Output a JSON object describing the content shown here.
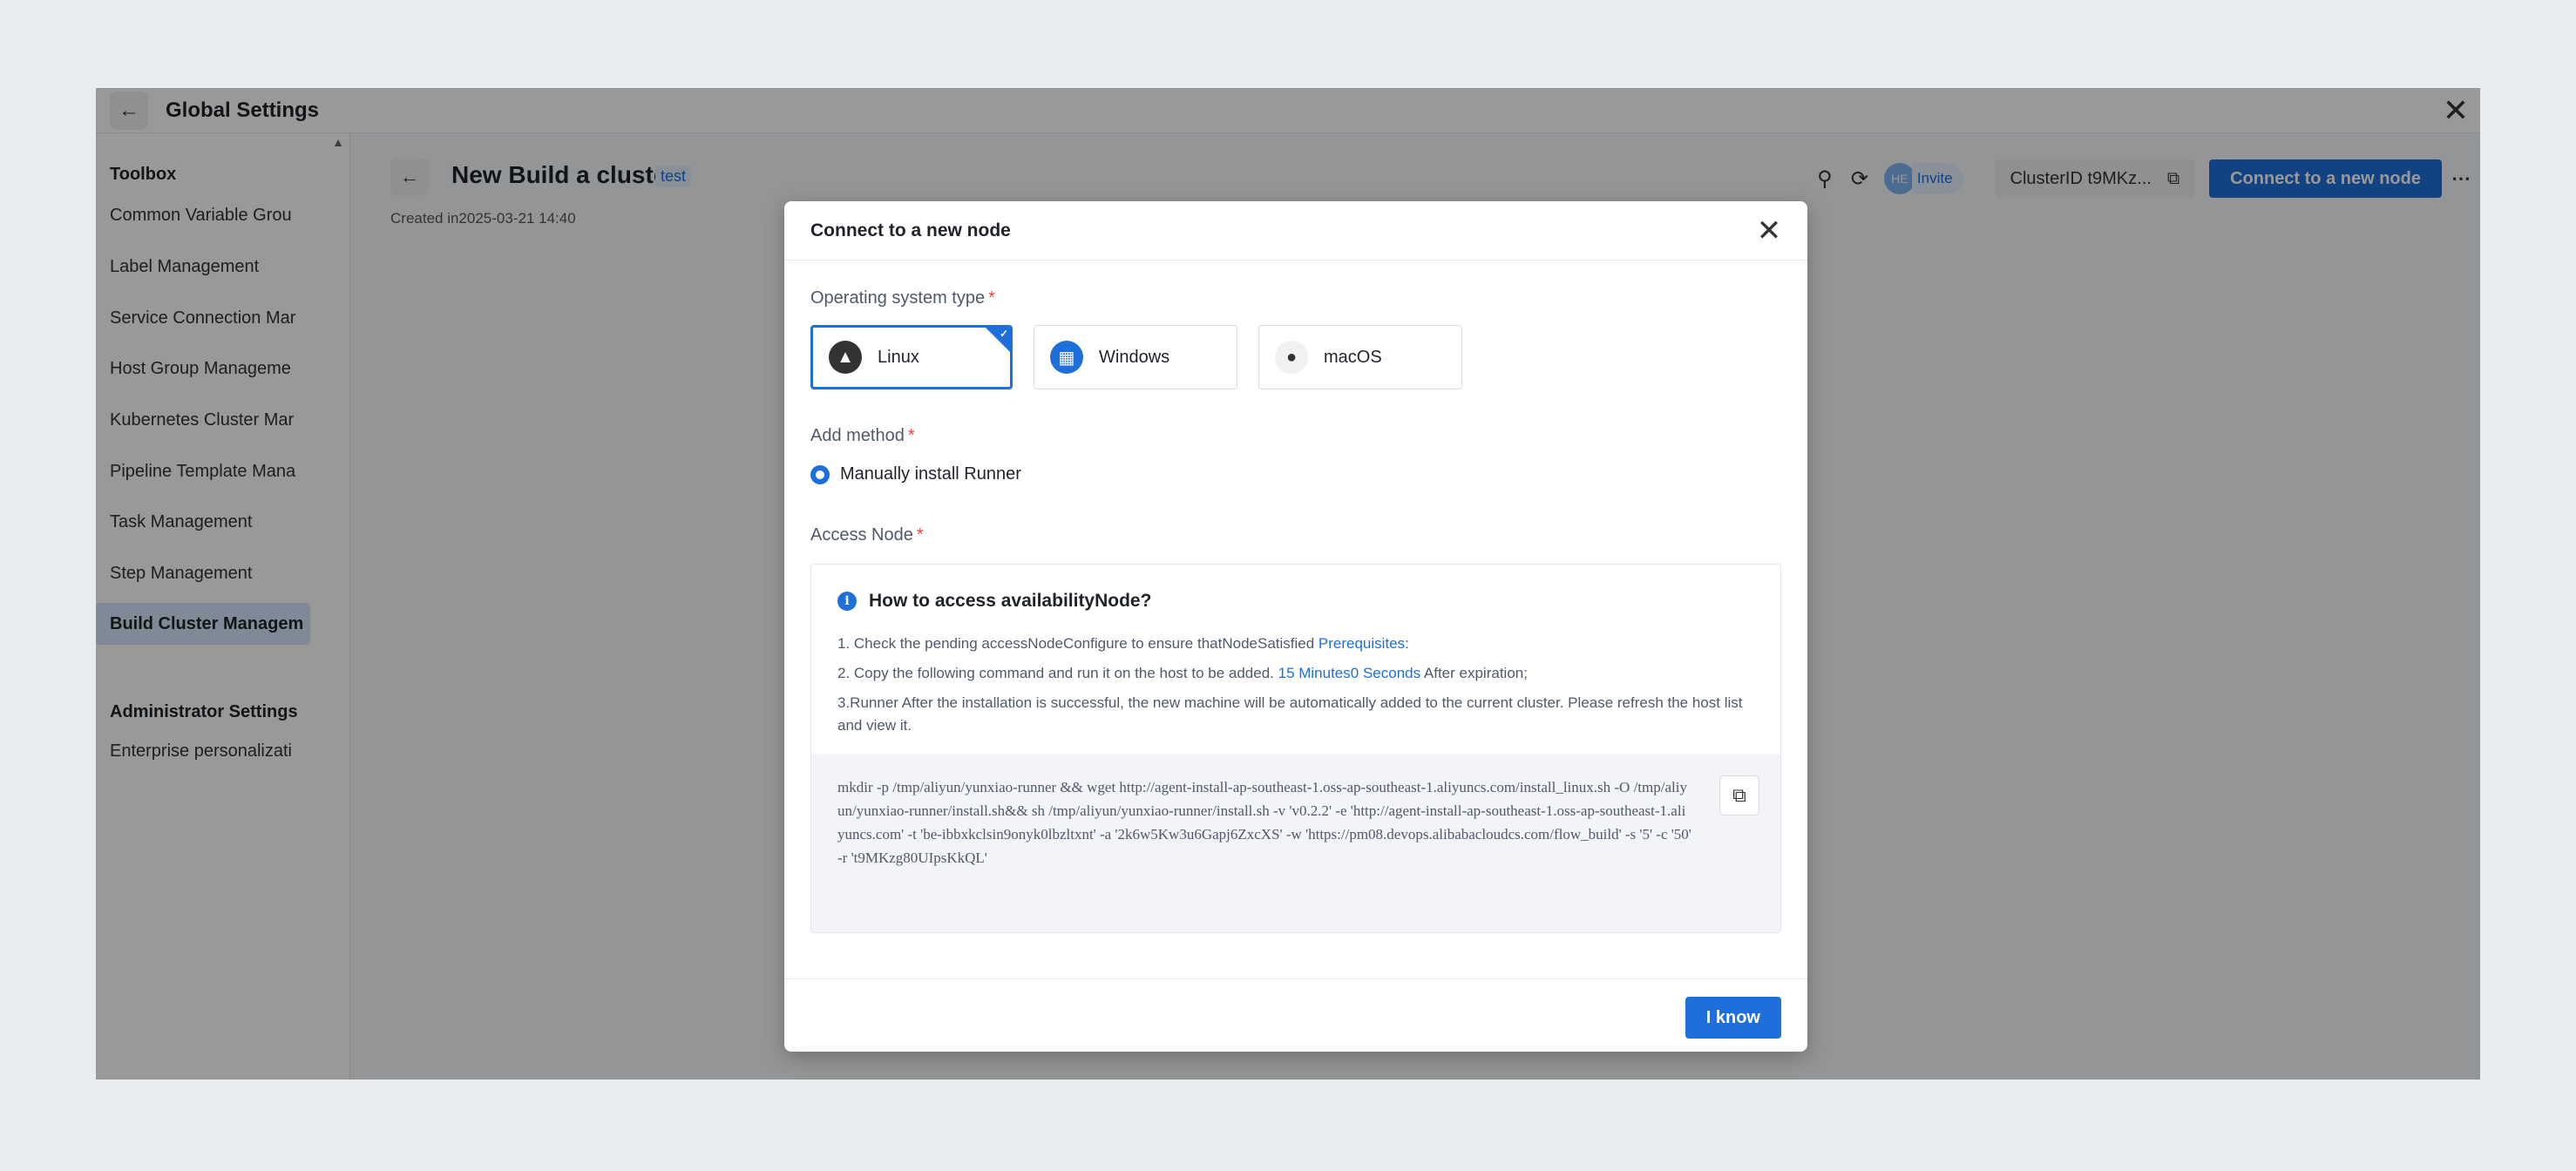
{
  "header": {
    "title": "Global Settings"
  },
  "sidebar": {
    "section1": "Toolbox",
    "items": [
      {
        "label": "Common Variable Grou"
      },
      {
        "label": "Label Management"
      },
      {
        "label": "Service Connection Mar"
      },
      {
        "label": "Host Group Manageme"
      },
      {
        "label": "Kubernetes Cluster Mar"
      },
      {
        "label": "Pipeline Template Mana"
      },
      {
        "label": "Task Management"
      },
      {
        "label": "Step Management"
      },
      {
        "label": "Build Cluster Managem"
      }
    ],
    "section2": "Administrator Settings",
    "admin_items": [
      {
        "label": "Enterprise personalizati"
      }
    ]
  },
  "page": {
    "title": "New Build a cluster",
    "tag": "test",
    "created": "Created in2025-03-21 14:40",
    "avatar": "HE",
    "invite": "Invite",
    "cluster_id": "ClusterID t9MKz...",
    "connect_button": "Connect to a new node"
  },
  "modal": {
    "title": "Connect to a new node",
    "os_label": "Operating system type",
    "os_options": [
      {
        "label": "Linux",
        "icon": "linux-icon",
        "selected": true
      },
      {
        "label": "Windows",
        "icon": "windows-icon",
        "selected": false
      },
      {
        "label": "macOS",
        "icon": "apple-icon",
        "selected": false
      }
    ],
    "method_label": "Add method",
    "method_option": "Manually install Runner",
    "access_label": "Access Node",
    "required_mark": "*",
    "access": {
      "heading": "How to access availabilityNode?",
      "step1_text": "1. Check the pending accessNodeConfigure to ensure thatNodeSatisfied ",
      "step1_link": "Prerequisites",
      "step1_end": ":",
      "step2_text": "2. Copy the following command and run it on the host to be added. ",
      "step2_link": "15 Minutes0 Seconds",
      "step2_end": " After expiration;",
      "step3_text": "3.Runner After the installation is successful, the new machine will be automatically added to the current cluster. Please refresh the host list and view it.",
      "command": "mkdir -p /tmp/aliyun/yunxiao-runner && wget http://agent-install-ap-southeast-1.oss-ap-southeast-1.aliyuncs.com/install_linux.sh -O /tmp/aliyun/yunxiao-runner/install.sh&& sh /tmp/aliyun/yunxiao-runner/install.sh -v 'v0.2.2' -e 'http://agent-install-ap-southeast-1.oss-ap-southeast-1.aliyuncs.com' -t 'be-ibbxkclsin9onyk0lbzltxnt' -a '2k6w5Kw3u6Gapj6ZxcXS' -w 'https://pm08.devops.alibabacloudcs.com/flow_build' -s '5' -c '50' -r 't9MKzg80UIpsKkQL'"
    },
    "ok_button": "I know"
  },
  "colors": {
    "accent": "#1e6fd9",
    "required": "#f53f3f"
  }
}
